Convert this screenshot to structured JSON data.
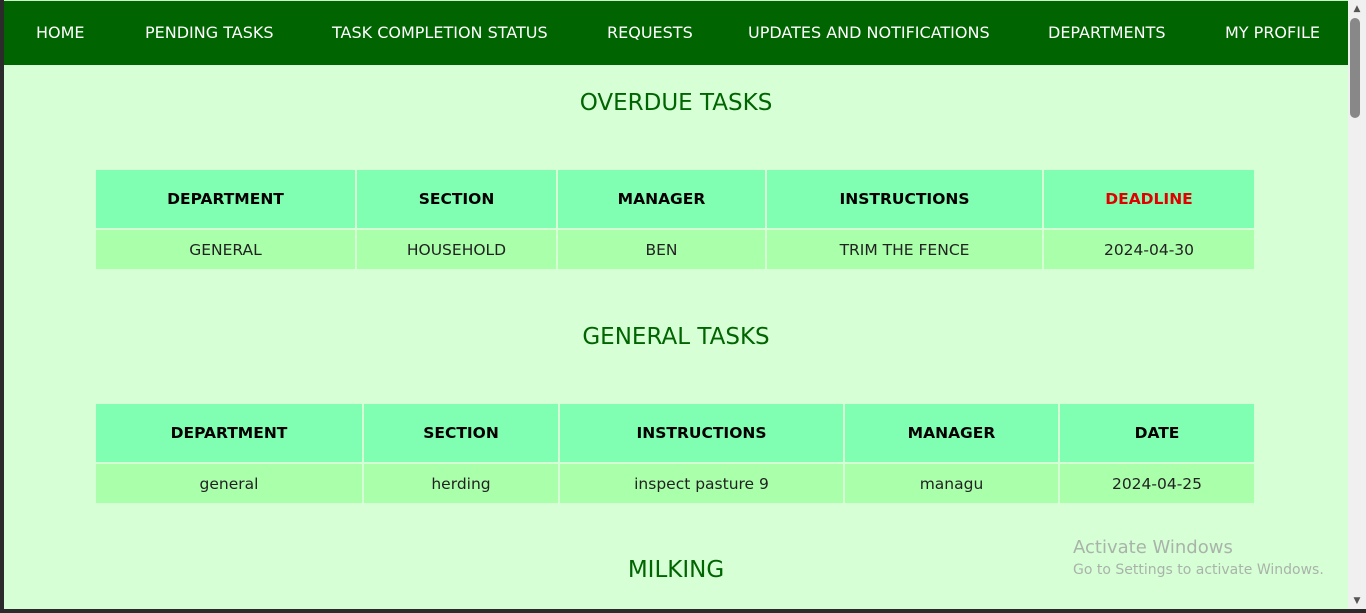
{
  "nav": {
    "items": [
      {
        "label": "HOME"
      },
      {
        "label": "PENDING TASKS"
      },
      {
        "label": "TASK COMPLETION STATUS"
      },
      {
        "label": "REQUESTS"
      },
      {
        "label": "UPDATES AND NOTIFICATIONS"
      },
      {
        "label": "DEPARTMENTS"
      },
      {
        "label": "MY PROFILE"
      }
    ]
  },
  "overdue": {
    "title": "OVERDUE TASKS",
    "headers": [
      "DEPARTMENT",
      "SECTION",
      "MANAGER",
      "INSTRUCTIONS",
      "DEADLINE"
    ],
    "rows": [
      [
        "GENERAL",
        "HOUSEHOLD",
        "BEN",
        "TRIM THE FENCE",
        "2024-04-30"
      ]
    ]
  },
  "general": {
    "title": "GENERAL TASKS",
    "headers": [
      "DEPARTMENT",
      "SECTION",
      "INSTRUCTIONS",
      "MANAGER",
      "DATE"
    ],
    "rows": [
      [
        "general",
        "herding",
        "inspect pasture 9",
        "managu",
        "2024-04-25"
      ]
    ]
  },
  "milking": {
    "title": "MILKING"
  },
  "watermark": {
    "line1": "Activate Windows",
    "line2": "Go to Settings to activate Windows."
  },
  "colors": {
    "nav_bg": "#006400",
    "page_bg": "#d6ffd6",
    "header_cell": "#80ffb3",
    "body_cell": "#aaffaa",
    "title_text": "#006400",
    "deadline_text": "#e00000"
  }
}
